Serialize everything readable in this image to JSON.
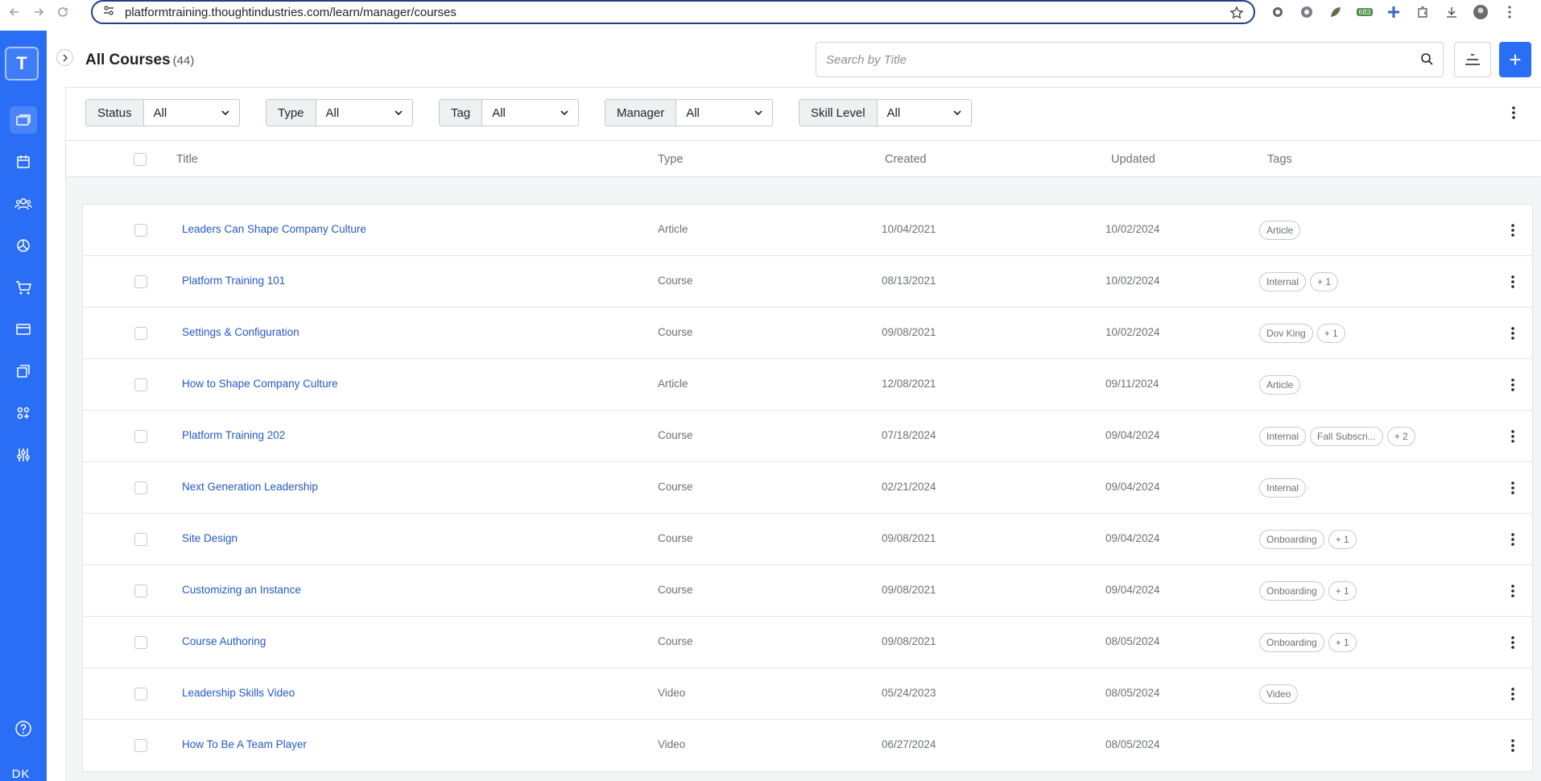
{
  "browser": {
    "url": "platformtraining.thoughtindustries.com/learn/manager/courses",
    "extension_badge": "683"
  },
  "sidebar": {
    "logo_letter": "T",
    "user_initials": "DK"
  },
  "header": {
    "title": "All Courses",
    "count": "(44)",
    "search_placeholder": "Search by Title",
    "add_label": "+"
  },
  "filters": [
    {
      "label": "Status",
      "value": "All"
    },
    {
      "label": "Type",
      "value": "All"
    },
    {
      "label": "Tag",
      "value": "All"
    },
    {
      "label": "Manager",
      "value": "All"
    },
    {
      "label": "Skill Level",
      "value": "All"
    }
  ],
  "columns": {
    "title": "Title",
    "type": "Type",
    "created": "Created",
    "updated": "Updated",
    "tags": "Tags"
  },
  "rows": [
    {
      "title": "Leaders Can Shape Company Culture",
      "type": "Article",
      "created": "10/04/2021",
      "updated": "10/02/2024",
      "tags": [
        "Article"
      ]
    },
    {
      "title": "Platform Training 101",
      "type": "Course",
      "created": "08/13/2021",
      "updated": "10/02/2024",
      "tags": [
        "Internal",
        "+ 1"
      ]
    },
    {
      "title": "Settings & Configuration",
      "type": "Course",
      "created": "09/08/2021",
      "updated": "10/02/2024",
      "tags": [
        "Dov King",
        "+ 1"
      ]
    },
    {
      "title": "How to Shape Company Culture",
      "type": "Article",
      "created": "12/08/2021",
      "updated": "09/11/2024",
      "tags": [
        "Article"
      ]
    },
    {
      "title": "Platform Training 202",
      "type": "Course",
      "created": "07/18/2024",
      "updated": "09/04/2024",
      "tags": [
        "Internal",
        "Fall Subscri...",
        "+ 2"
      ]
    },
    {
      "title": "Next Generation Leadership",
      "type": "Course",
      "created": "02/21/2024",
      "updated": "09/04/2024",
      "tags": [
        "Internal"
      ]
    },
    {
      "title": "Site Design",
      "type": "Course",
      "created": "09/08/2021",
      "updated": "09/04/2024",
      "tags": [
        "Onboarding",
        "+ 1"
      ]
    },
    {
      "title": "Customizing an Instance",
      "type": "Course",
      "created": "09/08/2021",
      "updated": "09/04/2024",
      "tags": [
        "Onboarding",
        "+ 1"
      ]
    },
    {
      "title": "Course Authoring",
      "type": "Course",
      "created": "09/08/2021",
      "updated": "08/05/2024",
      "tags": [
        "Onboarding",
        "+ 1"
      ]
    },
    {
      "title": "Leadership Skills Video",
      "type": "Video",
      "created": "05/24/2023",
      "updated": "08/05/2024",
      "tags": [
        "Video"
      ]
    },
    {
      "title": "How To Be A Team Player",
      "type": "Video",
      "created": "06/27/2024",
      "updated": "08/05/2024",
      "tags": []
    }
  ]
}
